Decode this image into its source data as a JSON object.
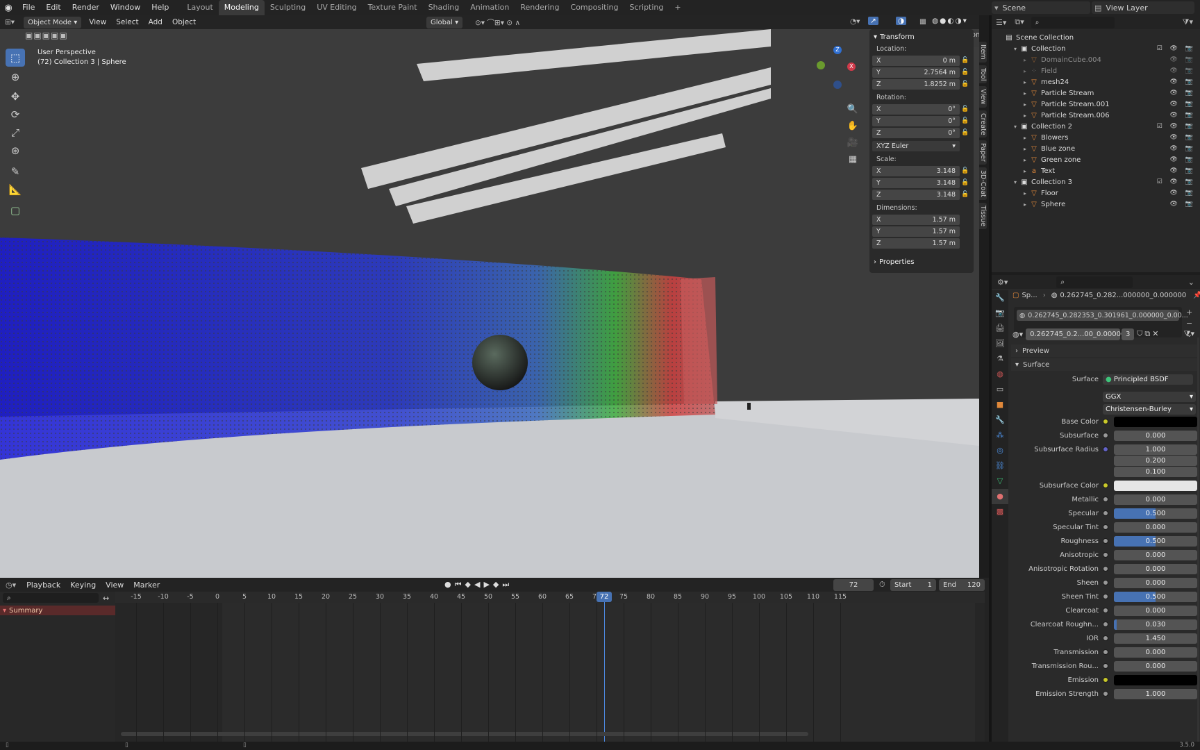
{
  "topbar": {
    "menus": [
      "File",
      "Edit",
      "Render",
      "Window",
      "Help"
    ],
    "workspaces": [
      {
        "label": "Layout",
        "active": false
      },
      {
        "label": "Modeling",
        "active": true
      },
      {
        "label": "Sculpting",
        "active": false
      },
      {
        "label": "UV Editing",
        "active": false
      },
      {
        "label": "Texture Paint",
        "active": false
      },
      {
        "label": "Shading",
        "active": false
      },
      {
        "label": "Animation",
        "active": false
      },
      {
        "label": "Rendering",
        "active": false
      },
      {
        "label": "Compositing",
        "active": false
      },
      {
        "label": "Scripting",
        "active": false
      }
    ],
    "add_tab": "+",
    "scene": "Scene",
    "view_layer": "View Layer"
  },
  "viewport": {
    "mode": "Object Mode",
    "menus": [
      "View",
      "Select",
      "Add",
      "Object"
    ],
    "orientation": "Global",
    "options": "Options",
    "overlay_title": "User Perspective",
    "overlay_sub": "(72) Collection 3 | Sphere",
    "gizmo": {
      "x": "X",
      "y": "Y",
      "z": "Z"
    }
  },
  "npanel": {
    "transform": "Transform",
    "location_label": "Location:",
    "location": [
      {
        "axis": "X",
        "val": "0 m"
      },
      {
        "axis": "Y",
        "val": "2.7564 m"
      },
      {
        "axis": "Z",
        "val": "1.8252 m"
      }
    ],
    "rotation_label": "Rotation:",
    "rotation": [
      {
        "axis": "X",
        "val": "0°"
      },
      {
        "axis": "Y",
        "val": "0°"
      },
      {
        "axis": "Z",
        "val": "0°"
      }
    ],
    "rotation_mode": "XYZ Euler",
    "scale_label": "Scale:",
    "scale": [
      {
        "axis": "X",
        "val": "3.148"
      },
      {
        "axis": "Y",
        "val": "3.148"
      },
      {
        "axis": "Z",
        "val": "3.148"
      }
    ],
    "dimensions_label": "Dimensions:",
    "dimensions": [
      {
        "axis": "X",
        "val": "1.57 m"
      },
      {
        "axis": "Y",
        "val": "1.57 m"
      },
      {
        "axis": "Z",
        "val": "1.57 m"
      }
    ],
    "properties": "Properties",
    "tabs": [
      "Item",
      "Tool",
      "View",
      "Create",
      "Paper",
      "3D-Coat",
      "Tissue"
    ]
  },
  "outliner": {
    "root": "Scene Collection",
    "rows": [
      {
        "label": "Collection",
        "indent": 1,
        "type": "coll"
      },
      {
        "label": "DomainCube.004",
        "indent": 2,
        "type": "mesh",
        "dim": true
      },
      {
        "label": "Field",
        "indent": 2,
        "type": "field",
        "dim": true
      },
      {
        "label": "mesh24",
        "indent": 2,
        "type": "mesh"
      },
      {
        "label": "Particle Stream",
        "indent": 2,
        "type": "mesh"
      },
      {
        "label": "Particle Stream.001",
        "indent": 2,
        "type": "mesh"
      },
      {
        "label": "Particle Stream.006",
        "indent": 2,
        "type": "mesh"
      },
      {
        "label": "Collection 2",
        "indent": 1,
        "type": "coll"
      },
      {
        "label": "Blowers",
        "indent": 2,
        "type": "mesh"
      },
      {
        "label": "Blue zone",
        "indent": 2,
        "type": "mesh"
      },
      {
        "label": "Green zone",
        "indent": 2,
        "type": "mesh"
      },
      {
        "label": "Text",
        "indent": 2,
        "type": "text"
      },
      {
        "label": "Collection 3",
        "indent": 1,
        "type": "coll"
      },
      {
        "label": "Floor",
        "indent": 2,
        "type": "mesh"
      },
      {
        "label": "Sphere",
        "indent": 2,
        "type": "mesh"
      }
    ]
  },
  "properties": {
    "breadcrumb_obj": "Sp...",
    "breadcrumb_mat": "0.262745_0.282...000000_0.000000",
    "slot": "0.262745_0.282353_0.301961_0.000000_0.00...",
    "material": "0.262745_0.2...00_0.000000",
    "users": "3",
    "preview": "Preview",
    "surface_panel": "Surface",
    "surface_label": "Surface",
    "surface_val": "Principled BSDF",
    "distribution": "GGX",
    "subsurface_method": "Christensen-Burley",
    "rows": [
      {
        "label": "Base Color",
        "val": "",
        "kind": "color",
        "color": "#000000",
        "dot": "#c8c82a"
      },
      {
        "label": "Subsurface",
        "val": "0.000",
        "fill": 0,
        "dot": "#999999"
      },
      {
        "label": "Subsurface Radius",
        "val": "1.000",
        "fill": 0,
        "dot": "#6363c7"
      },
      {
        "label": "",
        "val": "0.200",
        "fill": 0,
        "dot": ""
      },
      {
        "label": "",
        "val": "0.100",
        "fill": 0,
        "dot": ""
      },
      {
        "label": "Subsurface Color",
        "val": "",
        "kind": "color",
        "color": "#e6e6e6",
        "dot": "#c8c82a"
      },
      {
        "label": "Metallic",
        "val": "0.000",
        "fill": 0,
        "dot": "#999999"
      },
      {
        "label": "Specular",
        "val": "0.500",
        "fill": 0.5,
        "dot": "#999999"
      },
      {
        "label": "Specular Tint",
        "val": "0.000",
        "fill": 0,
        "dot": "#999999"
      },
      {
        "label": "Roughness",
        "val": "0.500",
        "fill": 0.5,
        "dot": "#999999"
      },
      {
        "label": "Anisotropic",
        "val": "0.000",
        "fill": 0,
        "dot": "#999999"
      },
      {
        "label": "Anisotropic Rotation",
        "val": "0.000",
        "fill": 0,
        "dot": "#999999"
      },
      {
        "label": "Sheen",
        "val": "0.000",
        "fill": 0,
        "dot": "#999999"
      },
      {
        "label": "Sheen Tint",
        "val": "0.500",
        "fill": 0.5,
        "dot": "#999999"
      },
      {
        "label": "Clearcoat",
        "val": "0.000",
        "fill": 0,
        "dot": "#999999"
      },
      {
        "label": "Clearcoat Roughn...",
        "val": "0.030",
        "fill": 0.03,
        "dot": "#999999"
      },
      {
        "label": "IOR",
        "val": "1.450",
        "fill": 0,
        "dot": "#999999"
      },
      {
        "label": "Transmission",
        "val": "0.000",
        "fill": 0,
        "dot": "#999999"
      },
      {
        "label": "Transmission Rou...",
        "val": "0.000",
        "fill": 0,
        "dot": "#999999"
      },
      {
        "label": "Emission",
        "val": "",
        "kind": "color",
        "color": "#000000",
        "dot": "#c8c82a"
      },
      {
        "label": "Emission Strength",
        "val": "1.000",
        "fill": 0,
        "dot": "#999999"
      }
    ]
  },
  "timeline": {
    "menus": [
      "Playback",
      "Keying",
      "View",
      "Marker"
    ],
    "current_frame": "72",
    "start_label": "Start",
    "start": "1",
    "end_label": "End",
    "end": "120",
    "ticks": [
      "-15",
      "-10",
      "-5",
      "0",
      "5",
      "10",
      "15",
      "20",
      "25",
      "30",
      "35",
      "40",
      "45",
      "50",
      "55",
      "60",
      "65",
      "70",
      "75",
      "80",
      "85",
      "90",
      "95",
      "100",
      "105",
      "110",
      "115"
    ],
    "summary": "Summary"
  },
  "status": {
    "version": "3.5.0"
  }
}
